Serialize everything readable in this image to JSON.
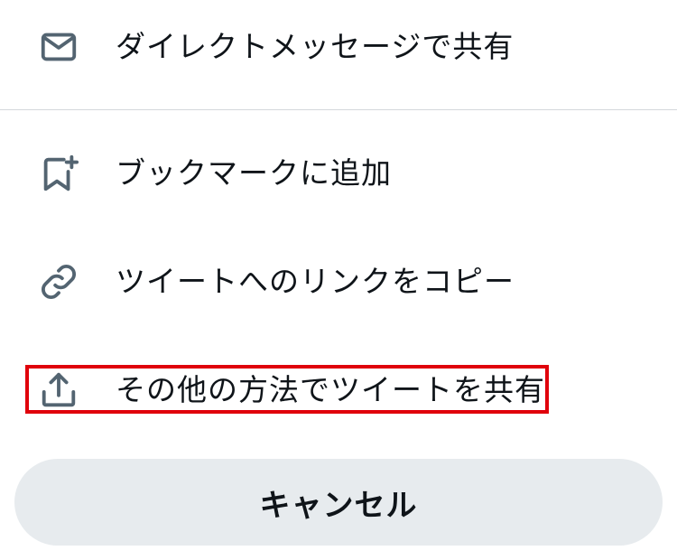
{
  "menu": {
    "items": [
      {
        "label": "ダイレクトメッセージで共有",
        "icon": "envelope-icon"
      },
      {
        "label": "ブックマークに追加",
        "icon": "bookmark-add-icon"
      },
      {
        "label": "ツイートへのリンクをコピー",
        "icon": "link-icon"
      },
      {
        "label": "その他の方法でツイートを共有",
        "icon": "share-upload-icon"
      }
    ]
  },
  "cancel": {
    "label": "キャンセル"
  },
  "colors": {
    "icon": "#536471",
    "text": "#0f1419",
    "highlight": "#e0000b",
    "cancel_bg": "#e7ebee",
    "divider": "#d4d8db"
  }
}
